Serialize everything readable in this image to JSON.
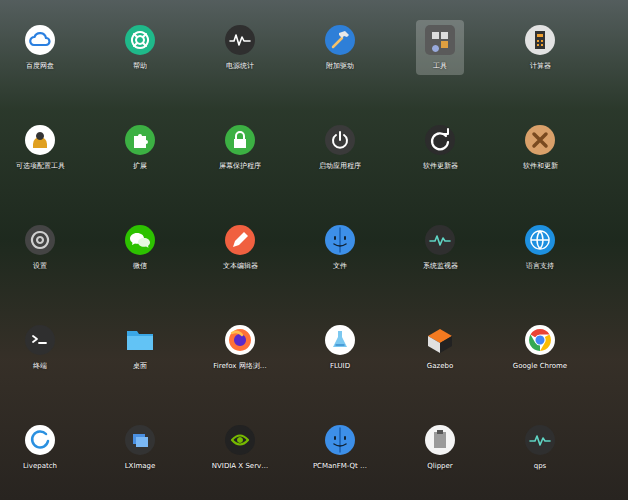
{
  "launcher": {
    "apps": [
      {
        "label": "百度网盘",
        "selected": false
      },
      {
        "label": "帮助",
        "selected": false
      },
      {
        "label": "电源统计",
        "selected": false
      },
      {
        "label": "附加驱动",
        "selected": false
      },
      {
        "label": "工具",
        "selected": true
      },
      {
        "label": "计算器",
        "selected": false
      },
      {
        "label": "可选项配置工具",
        "selected": false
      },
      {
        "label": "扩展",
        "selected": false
      },
      {
        "label": "屏幕保护程序",
        "selected": false
      },
      {
        "label": "启动应用程序",
        "selected": false
      },
      {
        "label": "软件更新器",
        "selected": false
      },
      {
        "label": "软件和更新",
        "selected": false
      },
      {
        "label": "设置",
        "selected": false
      },
      {
        "label": "微信",
        "selected": false
      },
      {
        "label": "文本编辑器",
        "selected": false
      },
      {
        "label": "文件",
        "selected": false
      },
      {
        "label": "系统监视器",
        "selected": false
      },
      {
        "label": "语言支持",
        "selected": false
      },
      {
        "label": "终端",
        "selected": false
      },
      {
        "label": "桌面",
        "selected": false
      },
      {
        "label": "Firefox 网络浏…",
        "selected": false
      },
      {
        "label": "FLUID",
        "selected": false
      },
      {
        "label": "Gazebo",
        "selected": false
      },
      {
        "label": "Google Chrome",
        "selected": false
      },
      {
        "label": "Livepatch",
        "selected": false
      },
      {
        "label": "LXImage",
        "selected": false
      },
      {
        "label": "NVIDIA X Serv…",
        "selected": false
      },
      {
        "label": "PCManFM-Qt …",
        "selected": false
      },
      {
        "label": "Qlipper",
        "selected": false
      },
      {
        "label": "qps",
        "selected": false
      }
    ]
  }
}
